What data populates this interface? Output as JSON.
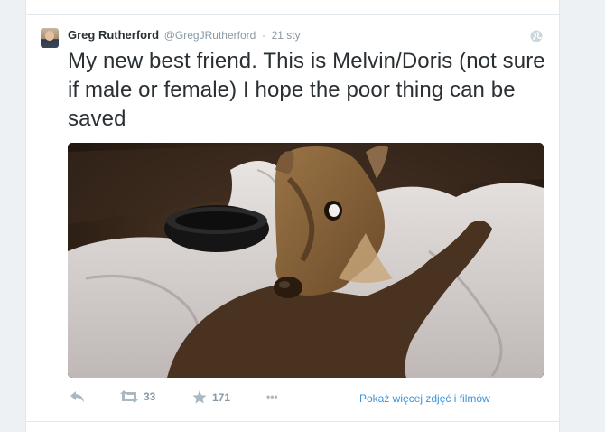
{
  "tweet": {
    "author_name": "Greg Rutherford",
    "author_handle": "@GregJRutherford",
    "separator": "·",
    "timestamp": "21 sty",
    "text": "My new best friend. This is Melvin/Doris (not sure if male or female) I hope the poor thing can be saved",
    "photo_subject": "small deer lying on a blanket"
  },
  "actions": {
    "retweet_count": "33",
    "favorite_count": "171",
    "more_label": "•••",
    "media_link": "Pokaż więcej zdjęć i filmów"
  },
  "icons": {
    "reply": "reply-icon",
    "retweet": "retweet-icon",
    "favorite": "star-icon",
    "more": "more-icon",
    "globe": "globe-icon"
  },
  "colors": {
    "text": "#292f33",
    "muted": "#8899a6",
    "link": "#3b94d9",
    "border": "#e1e8ed"
  }
}
